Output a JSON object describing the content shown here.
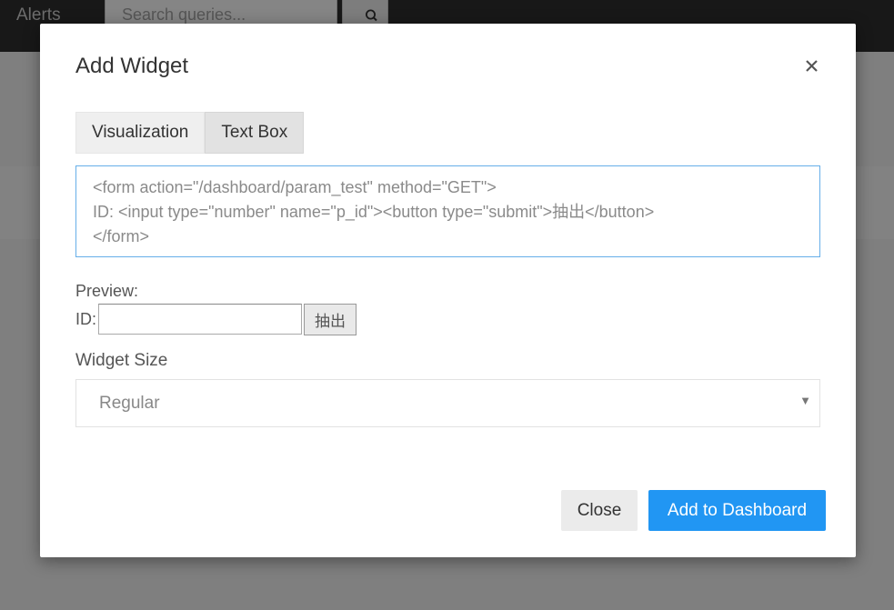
{
  "topbar": {
    "nav_alerts": "Alerts",
    "search_placeholder": "Search queries..."
  },
  "modal": {
    "title": "Add Widget",
    "tabs": [
      {
        "label": "Visualization",
        "active": false
      },
      {
        "label": "Text Box",
        "active": true
      }
    ],
    "editor_text": "<form action=\"/dashboard/param_test\" method=\"GET\">\nID: <input type=\"number\" name=\"p_id\"><button type=\"submit\">抽出</button>\n</form>",
    "preview": {
      "label": "Preview:",
      "id_label": "ID:",
      "submit_label": "抽出"
    },
    "widget_size": {
      "label": "Widget Size",
      "selected": "Regular"
    },
    "buttons": {
      "close": "Close",
      "add": "Add to Dashboard"
    }
  },
  "colors": {
    "primary": "#2196f3",
    "editor_focus": "#66afe9",
    "topbar": "#2f2f2f"
  }
}
